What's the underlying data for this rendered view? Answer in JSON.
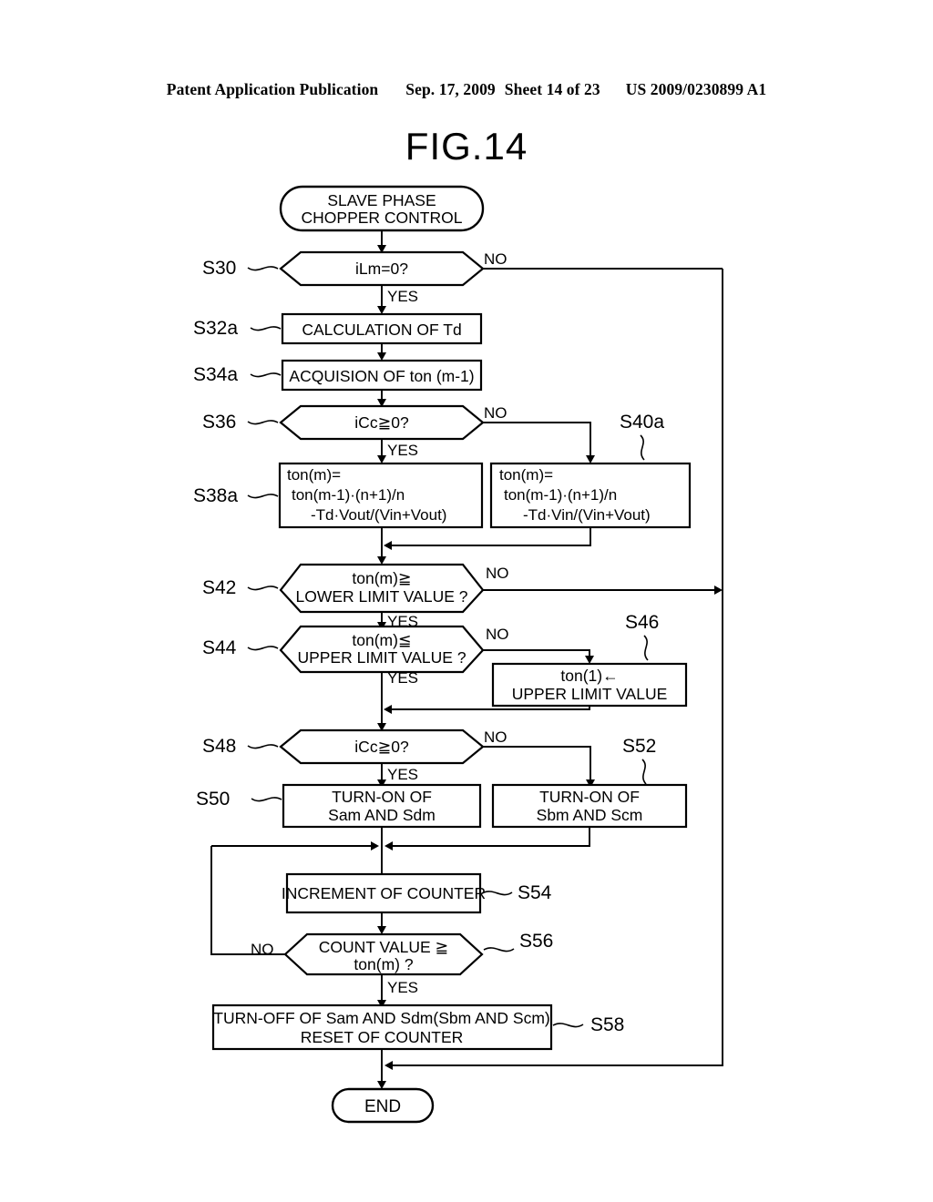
{
  "header": {
    "publication": "Patent Application Publication",
    "date": "Sep. 17, 2009",
    "sheet": "Sheet 14 of 23",
    "docnum": "US 2009/0230899 A1"
  },
  "figure": {
    "label": "FIG.14"
  },
  "nodes": {
    "start": {
      "line1": "SLAVE PHASE",
      "line2": "CHOPPER CONTROL"
    },
    "s30": {
      "step": "S30",
      "text": "iLm=0?",
      "yes": "YES",
      "no": "NO"
    },
    "s32a": {
      "step": "S32a",
      "text": "CALCULATION OF Td"
    },
    "s34a": {
      "step": "S34a",
      "text": "ACQUISION OF ton (m-1)"
    },
    "s36": {
      "step": "S36",
      "text": "iCc≧0?",
      "yes": "YES",
      "no": "NO"
    },
    "s38a": {
      "step": "S38a",
      "line1": "ton(m)=",
      "line2": "ton(m-1)·(n+1)/n",
      "line3": "-Td·Vout/(Vin+Vout)"
    },
    "s40a": {
      "step": "S40a",
      "line1": "ton(m)=",
      "line2": "ton(m-1)·(n+1)/n",
      "line3": "-Td·Vin/(Vin+Vout)"
    },
    "s42": {
      "step": "S42",
      "line1": "ton(m)≧",
      "line2": "LOWER LIMIT VALUE ?",
      "yes": "YES",
      "no": "NO"
    },
    "s44": {
      "step": "S44",
      "line1": "ton(m)≦",
      "line2": "UPPER LIMIT VALUE ?",
      "yes": "YES",
      "no": "NO"
    },
    "s46": {
      "step": "S46",
      "line1": "ton(1)←",
      "line2": "UPPER LIMIT VALUE"
    },
    "s48": {
      "step": "S48",
      "text": "iCc≧0?",
      "yes": "YES",
      "no": "NO"
    },
    "s50": {
      "step": "S50",
      "line1": "TURN-ON OF",
      "line2": "Sam AND Sdm"
    },
    "s52": {
      "step": "S52",
      "line1": "TURN-ON OF",
      "line2": "Sbm AND Scm"
    },
    "s54": {
      "step": "S54",
      "text": "INCREMENT OF COUNTER"
    },
    "s56": {
      "step": "S56",
      "line1": "COUNT VALUE ≧",
      "line2": "ton(m) ?",
      "yes": "YES",
      "no": "NO"
    },
    "s58": {
      "step": "S58",
      "line1": "TURN-OFF OF Sam AND Sdm(Sbm AND Scm)",
      "line2": "RESET OF COUNTER"
    },
    "end": {
      "text": "END"
    }
  },
  "colors": {
    "ink": "#000000",
    "paper": "#ffffff"
  }
}
